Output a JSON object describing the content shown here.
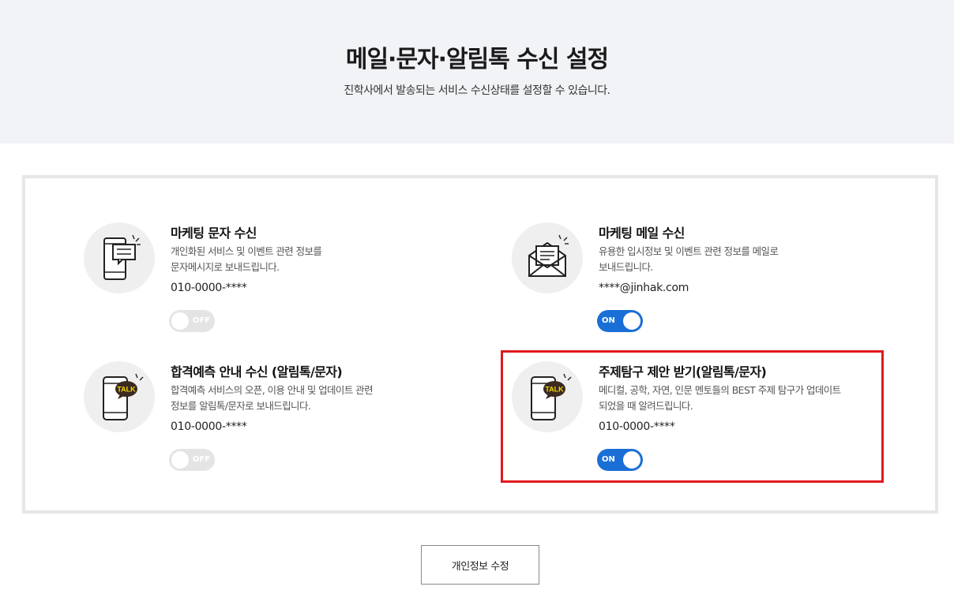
{
  "header": {
    "title": "메일·문자·알림톡 수신 설정",
    "subtitle": "진학사에서 발송되는 서비스 수신상태를 설정할 수 있습니다."
  },
  "settings": [
    {
      "title": "마케팅 문자 수신",
      "desc_line1": "개인화된 서비스 및 이벤트 관련 정보를",
      "desc_line2": "문자메시지로 보내드립니다.",
      "value": "010-0000-****",
      "toggle_label": "OFF",
      "icon": "phone-message-icon"
    },
    {
      "title": "마케팅 메일 수신",
      "desc_line1": "유용한 입시정보 및 이벤트 관련 정보를 메일로",
      "desc_line2": "보내드립니다.",
      "value": "****@jinhak.com",
      "toggle_label": "ON",
      "icon": "envelope-icon"
    },
    {
      "title": "합격예측 안내 수신 (알림톡/문자)",
      "desc_line1": "합격예측 서비스의 오픈, 이용 안내 및 업데이트 관련",
      "desc_line2": "정보를 알림톡/문자로 보내드립니다.",
      "value": "010-0000-****",
      "toggle_label": "OFF",
      "icon": "phone-talk-icon",
      "badge": "TALK"
    },
    {
      "title": "주제탐구 제안 받기(알림톡/문자)",
      "desc_line1": "메디컬, 공학, 자연, 인문 멘토들의 BEST 주제 탐구가 업데이트",
      "desc_line2": "되었을 때 알려드립니다.",
      "value": "010-0000-****",
      "toggle_label": "ON",
      "icon": "phone-talk-icon",
      "badge": "TALK"
    }
  ],
  "footer": {
    "edit_button": "개인정보 수정"
  },
  "colors": {
    "hero_bg": "#f2f3f6",
    "toggle_on": "#1a6fd6",
    "toggle_off": "#e4e4e4",
    "highlight": "#e0191c",
    "talk_badge": "#3a2a1f"
  }
}
